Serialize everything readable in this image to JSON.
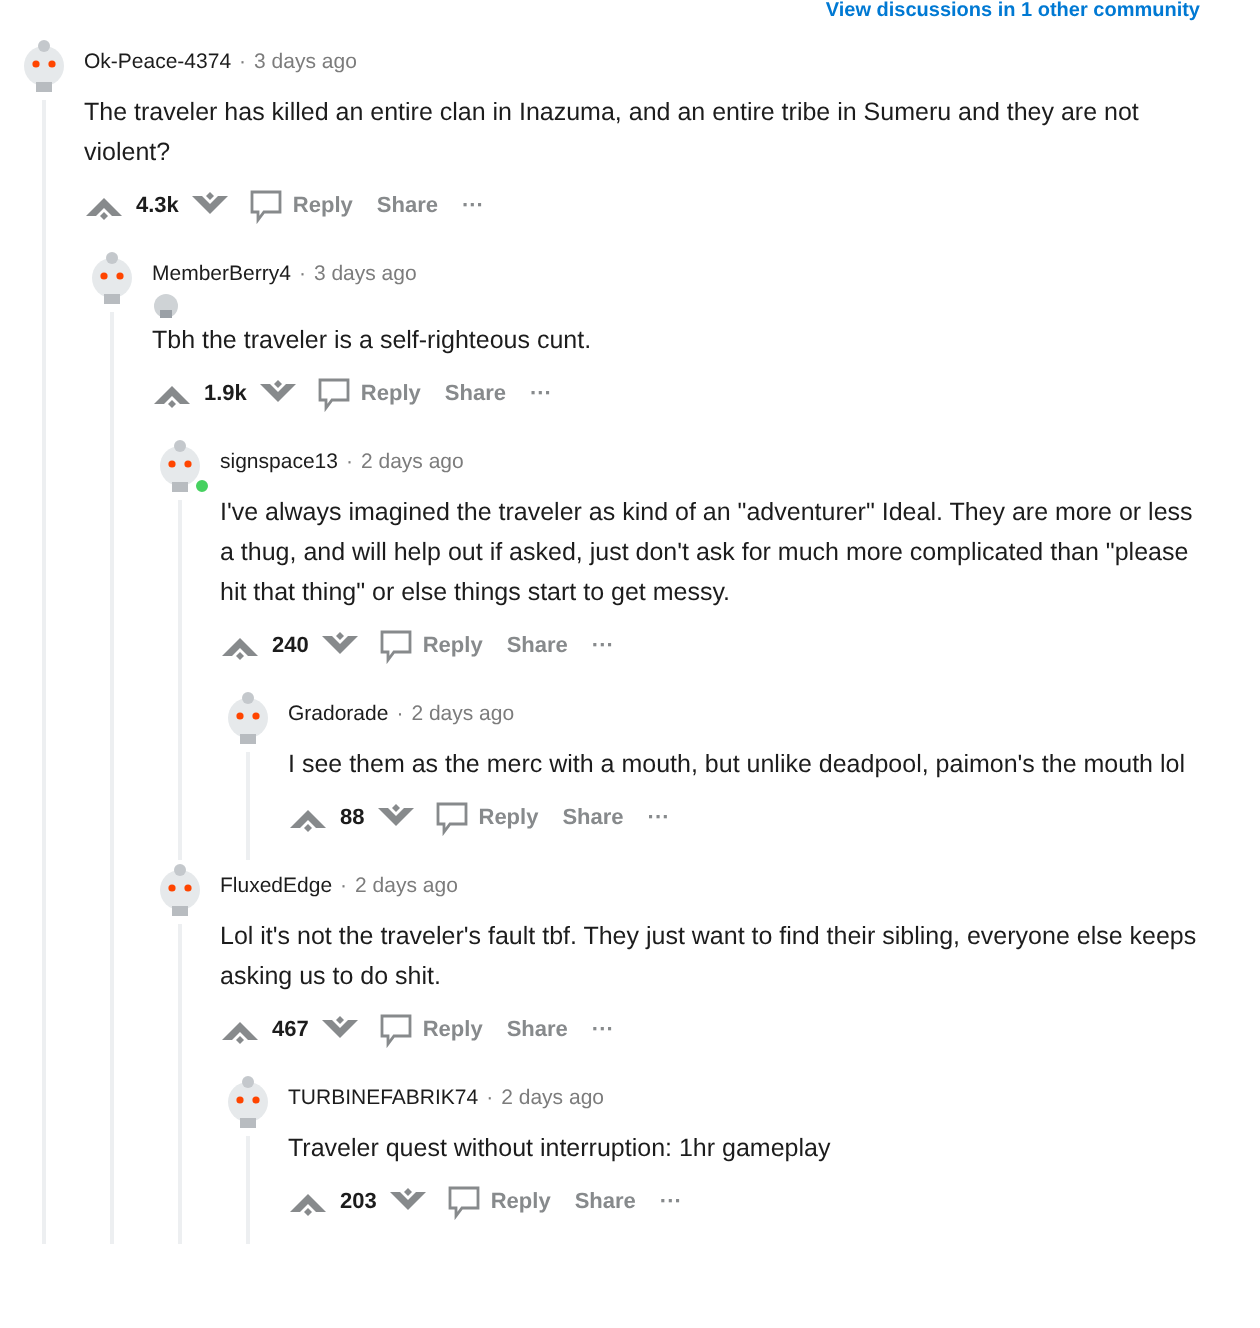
{
  "top_link": "View discussions in 1 other community",
  "comments": [
    {
      "username": "Ok-Peace-4374",
      "separator": "·",
      "time": "3 days ago",
      "online": false,
      "flair_icon": false,
      "body": "The traveler has killed an entire clan in Inazuma, and an entire tribe in Sumeru and they are not violent?",
      "votes": "4.3k",
      "reply": "Reply",
      "share": "Share",
      "more": "···",
      "children": [
        {
          "username": "MemberBerry4",
          "separator": "·",
          "time": "3 days ago",
          "online": false,
          "flair_icon": true,
          "body": "Tbh the traveler is a self-righteous cunt.",
          "votes": "1.9k",
          "reply": "Reply",
          "share": "Share",
          "more": "···",
          "children": [
            {
              "username": "signspace13",
              "separator": "·",
              "time": "2 days ago",
              "online": true,
              "flair_icon": false,
              "body": "I've always imagined the traveler as kind of an \"adventurer\" Ideal. They are more or less a thug, and will help out if asked, just don't ask for much more complicated than \"please hit that thing\" or else things start to get messy.",
              "votes": "240",
              "reply": "Reply",
              "share": "Share",
              "more": "···",
              "children": [
                {
                  "username": "Gradorade",
                  "separator": "·",
                  "time": "2 days ago",
                  "online": false,
                  "flair_icon": false,
                  "body": "I see them as the merc with a mouth, but unlike deadpool, paimon's the mouth lol",
                  "votes": "88",
                  "reply": "Reply",
                  "share": "Share",
                  "more": "···"
                }
              ]
            },
            {
              "username": "FluxedEdge",
              "separator": "·",
              "time": "2 days ago",
              "online": false,
              "flair_icon": false,
              "body": "Lol it's not the traveler's fault tbf. They just want to find their sibling, everyone else keeps asking us to do shit.",
              "votes": "467",
              "reply": "Reply",
              "share": "Share",
              "more": "···",
              "children": [
                {
                  "username": "TURBINEFABRIK74",
                  "separator": "·",
                  "time": "2 days ago",
                  "online": false,
                  "flair_icon": false,
                  "body": "Traveler quest without interruption: 1hr gameplay",
                  "votes": "203",
                  "reply": "Reply",
                  "share": "Share",
                  "more": "···"
                }
              ]
            }
          ]
        }
      ]
    }
  ]
}
